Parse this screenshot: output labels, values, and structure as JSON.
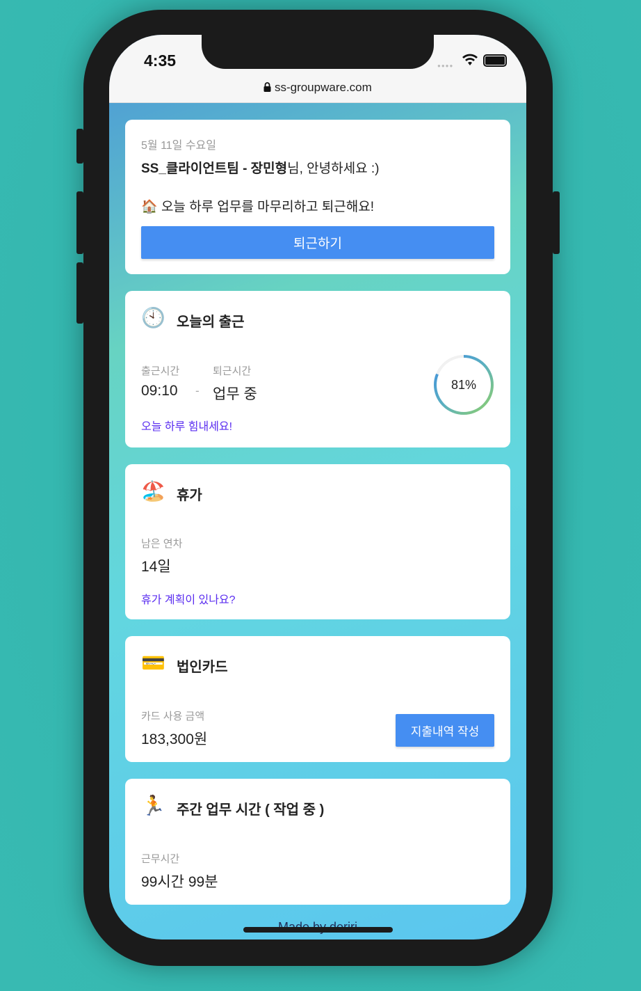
{
  "status_bar": {
    "time": "4:35",
    "signal_icon": "signal-dots-icon",
    "wifi_icon": "wifi-icon",
    "battery_icon": "battery-icon"
  },
  "browser": {
    "url": "ss-groupware.com",
    "lock_icon": "lock-icon"
  },
  "greeting": {
    "date": "5월 11일 수요일",
    "team_name": "SS_클라이언트팀 - 장민형",
    "greeting_suffix": "님, 안녕하세요 :)",
    "message_emoji": "🏠",
    "message": "오늘 하루 업무를 마무리하고 퇴근해요!",
    "checkout_button": "퇴근하기"
  },
  "attendance": {
    "emoji": "🕙",
    "title": "오늘의 출근",
    "checkin_label": "출근시간",
    "checkout_label": "퇴근시간",
    "checkin_value": "09:10",
    "separator": "-",
    "checkout_value": "업무 중",
    "progress_percent": 81,
    "progress_label": "81%",
    "link": "오늘 하루 힘내세요!"
  },
  "vacation": {
    "emoji": "🏖️",
    "title": "휴가",
    "remaining_label": "남은 연차",
    "remaining_value": "14일",
    "link": "휴가 계획이 있나요?"
  },
  "corporate_card": {
    "emoji": "💳",
    "title": "법인카드",
    "amount_label": "카드 사용 금액",
    "amount_value": "183,300원",
    "expense_button": "지출내역 작성"
  },
  "weekly": {
    "emoji": "🏃",
    "title": "주간 업무 시간 ( 작업 중 )",
    "hours_label": "근무시간",
    "hours_value": "99시간 99분"
  },
  "footer": {
    "credit": "Made by deriri"
  },
  "colors": {
    "background": "#35b8b0",
    "primary": "#458ef2",
    "link": "#5a2df0"
  }
}
